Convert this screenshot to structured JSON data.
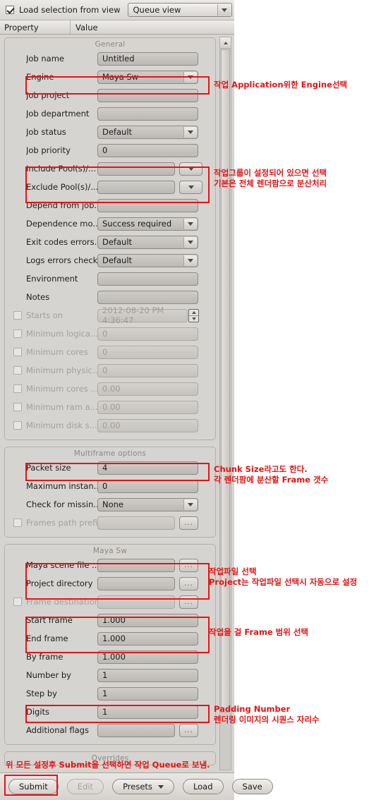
{
  "topbar": {
    "checkbox_label": "Load selection from view",
    "checkbox_checked": true,
    "view_select_value": "Queue view"
  },
  "columns": {
    "property": "Property",
    "value": "Value"
  },
  "groups": [
    {
      "title": "General",
      "rows": [
        {
          "label": "Job name",
          "value": "Untitled",
          "type": "text"
        },
        {
          "label": "Engine",
          "value": "Maya Sw",
          "type": "combo"
        },
        {
          "label": "Job project",
          "value": "",
          "type": "text"
        },
        {
          "label": "Job department",
          "value": "",
          "type": "text"
        },
        {
          "label": "Job status",
          "value": "Default",
          "type": "combo"
        },
        {
          "label": "Job priority",
          "value": "0",
          "type": "text"
        },
        {
          "label": "Include Pool(s)/...",
          "value": "",
          "type": "text-arrow"
        },
        {
          "label": "Exclude Pool(s)/...",
          "value": "",
          "type": "text-arrow"
        },
        {
          "label": "Depend from job...",
          "value": "",
          "type": "text"
        },
        {
          "label": "Dependence mo...",
          "value": "Success required",
          "type": "combo"
        },
        {
          "label": "Exit codes errors...",
          "value": "Default",
          "type": "combo"
        },
        {
          "label": "Logs errors check",
          "value": "Default",
          "type": "combo"
        },
        {
          "label": "Environment",
          "value": "",
          "type": "text"
        },
        {
          "label": "Notes",
          "value": "",
          "type": "text"
        },
        {
          "label": "Starts on",
          "value": "2012-08-20 PM 4:36:47",
          "type": "spin",
          "checkbox": true,
          "checked": false,
          "disabled": true
        },
        {
          "label": "Minimum logica...",
          "value": "0",
          "type": "text",
          "checkbox": true,
          "checked": false,
          "disabled": true
        },
        {
          "label": "Minimum cores",
          "value": "0",
          "type": "text",
          "checkbox": true,
          "checked": false,
          "disabled": true
        },
        {
          "label": "Minimum physic...",
          "value": "0",
          "type": "text",
          "checkbox": true,
          "checked": false,
          "disabled": true
        },
        {
          "label": "Minimum cores ...",
          "value": "0.00",
          "type": "text",
          "checkbox": true,
          "checked": false,
          "disabled": true
        },
        {
          "label": "Minimum ram a...",
          "value": "0.00",
          "type": "text",
          "checkbox": true,
          "checked": false,
          "disabled": true
        },
        {
          "label": "Minimum disk s...",
          "value": "0.00",
          "type": "text",
          "checkbox": true,
          "checked": false,
          "disabled": true
        }
      ]
    },
    {
      "title": "Multiframe options",
      "rows": [
        {
          "label": "Packet size",
          "value": "4",
          "type": "text"
        },
        {
          "label": "Maximum instan...",
          "value": "0",
          "type": "text"
        },
        {
          "label": "Check for missin...",
          "value": "None",
          "type": "combo"
        },
        {
          "label": "Frames path prefix",
          "value": "",
          "type": "text-ellipsis",
          "checkbox": true,
          "checked": false,
          "disabled": true
        }
      ]
    },
    {
      "title": "Maya Sw",
      "rows": [
        {
          "label": "Maya scene file ...",
          "value": "",
          "type": "text-ellipsis"
        },
        {
          "label": "Project directory",
          "value": "",
          "type": "text-ellipsis"
        },
        {
          "label": "Frame destination",
          "value": "",
          "type": "text-ellipsis",
          "checkbox": true,
          "checked": false,
          "disabled": true
        },
        {
          "label": "Start frame",
          "value": "1.000",
          "type": "text"
        },
        {
          "label": "End frame",
          "value": "1.000",
          "type": "text"
        },
        {
          "label": "By frame",
          "value": "1.000",
          "type": "text"
        },
        {
          "label": "Number by",
          "value": "1",
          "type": "text"
        },
        {
          "label": "Step by",
          "value": "1",
          "type": "text"
        },
        {
          "label": "Digits",
          "value": "1",
          "type": "text"
        },
        {
          "label": "Additional flags",
          "value": "",
          "type": "text-ellipsis"
        }
      ]
    },
    {
      "title": "Overrides",
      "rows": []
    }
  ],
  "bottom_buttons": [
    {
      "label": "Submit",
      "disabled": false,
      "dropdown": false
    },
    {
      "label": "Edit",
      "disabled": true,
      "dropdown": false
    },
    {
      "label": "Presets",
      "disabled": false,
      "dropdown": true
    },
    {
      "label": "Load",
      "disabled": false,
      "dropdown": false
    },
    {
      "label": "Save",
      "disabled": false,
      "dropdown": false
    }
  ],
  "annotations": [
    {
      "id": "engine",
      "lines": [
        "작업  Application위한  Engine선택"
      ]
    },
    {
      "id": "pools",
      "lines": [
        "작업그룹이  설정되어  있으면  선택",
        "기본은  전체  렌더팜으로  분산처리"
      ]
    },
    {
      "id": "packet",
      "lines": [
        "Chunk Size라고도  한다.",
        "각  렌더팜에  분산할  Frame  갯수"
      ]
    },
    {
      "id": "scene",
      "lines": [
        "작업파일  선택",
        "Project는  작업파일  선택시  자동으로  설정"
      ]
    },
    {
      "id": "frames",
      "lines": [
        "작업을  걸  Frame  범위  선택"
      ]
    },
    {
      "id": "digits",
      "lines": [
        "Padding Number",
        "렌더링  이미지의  시퀀스  자리수"
      ]
    },
    {
      "id": "submit",
      "lines": [
        "위  모든  설정후  Submit을  선택하면  작업  Queue로  보냄."
      ]
    }
  ],
  "colors": {
    "highlight": "#e81313",
    "panel": "#d6d4d0"
  }
}
